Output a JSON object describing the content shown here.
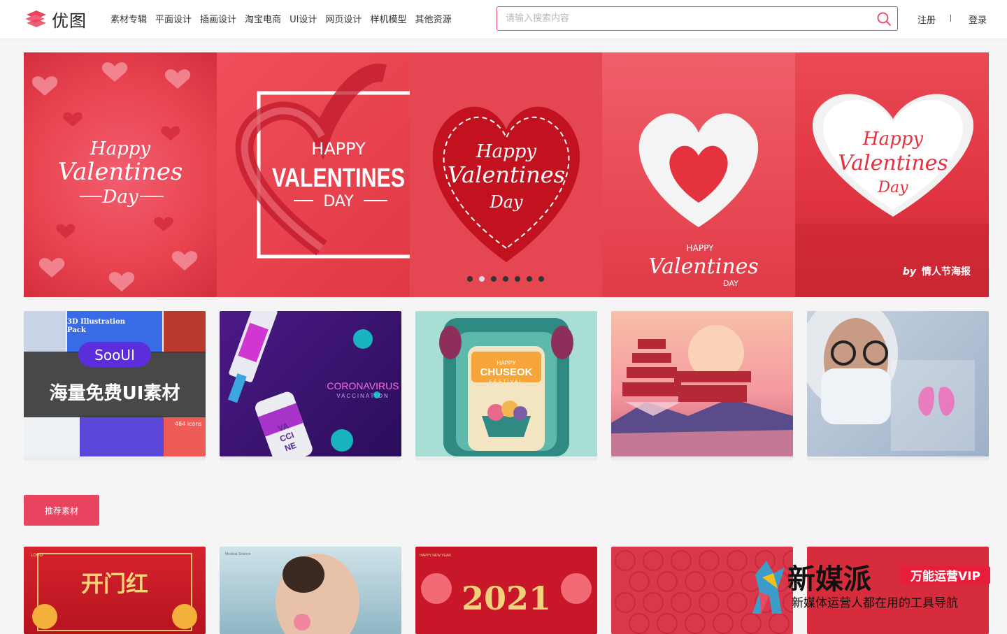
{
  "header": {
    "logo_text": "优图",
    "nav": [
      "素材专辑",
      "平面设计",
      "插画设计",
      "淘宝电商",
      "UI设计",
      "网页设计",
      "样机模型",
      "其他资源"
    ],
    "search_placeholder": "请输入搜索内容",
    "register": "注册",
    "login": "登录"
  },
  "banner": {
    "panels": [
      {
        "line1": "Happy",
        "line2": "Valentines",
        "line3": "Day"
      },
      {
        "line1": "HAPPY",
        "line2": "VALENTINES",
        "line3": "DAY"
      },
      {
        "line1": "Happy",
        "line2": "Valentines",
        "line3": "Day"
      },
      {
        "line1": "HAPPY",
        "line2": "Valentines",
        "line3": "DAY"
      },
      {
        "line1": "Happy",
        "line2": "Valentines",
        "line3": "Day"
      }
    ],
    "dot_count": 7,
    "active_dot": 1,
    "byline_by": "by",
    "byline_text": "情人节海报"
  },
  "cards": [
    {
      "badge": "SooUI",
      "title": "海量免费UI素材",
      "sub1": "3D Illustration",
      "sub2": "Pack",
      "sub3": "484 icons"
    },
    {
      "title": "CORONAVIRUS",
      "sub": "VACCINATION",
      "vial_text": [
        "VA",
        "CCI",
        "NE"
      ]
    },
    {
      "title": "CHUSEOK",
      "pre": "HAPPY",
      "sub": "FESTIVAL"
    },
    {
      "title": ""
    },
    {
      "title": ""
    }
  ],
  "section": {
    "recommend_label": "推荐素材"
  },
  "bottom_cards": [
    {
      "title": "开门红",
      "tag": "LOGO"
    },
    {
      "title": "Medical Science"
    },
    {
      "title": "2021",
      "tag": "HAPPY NEW YEAR"
    },
    {
      "title": ""
    },
    {
      "title": ""
    }
  ],
  "watermark": {
    "title": "新媒派",
    "badge": "万能运营VIP",
    "subtitle": "新媒体运营人都在用的工具导航"
  },
  "colors": {
    "accent": "#e8435f",
    "banner_red": "#e23a48"
  }
}
